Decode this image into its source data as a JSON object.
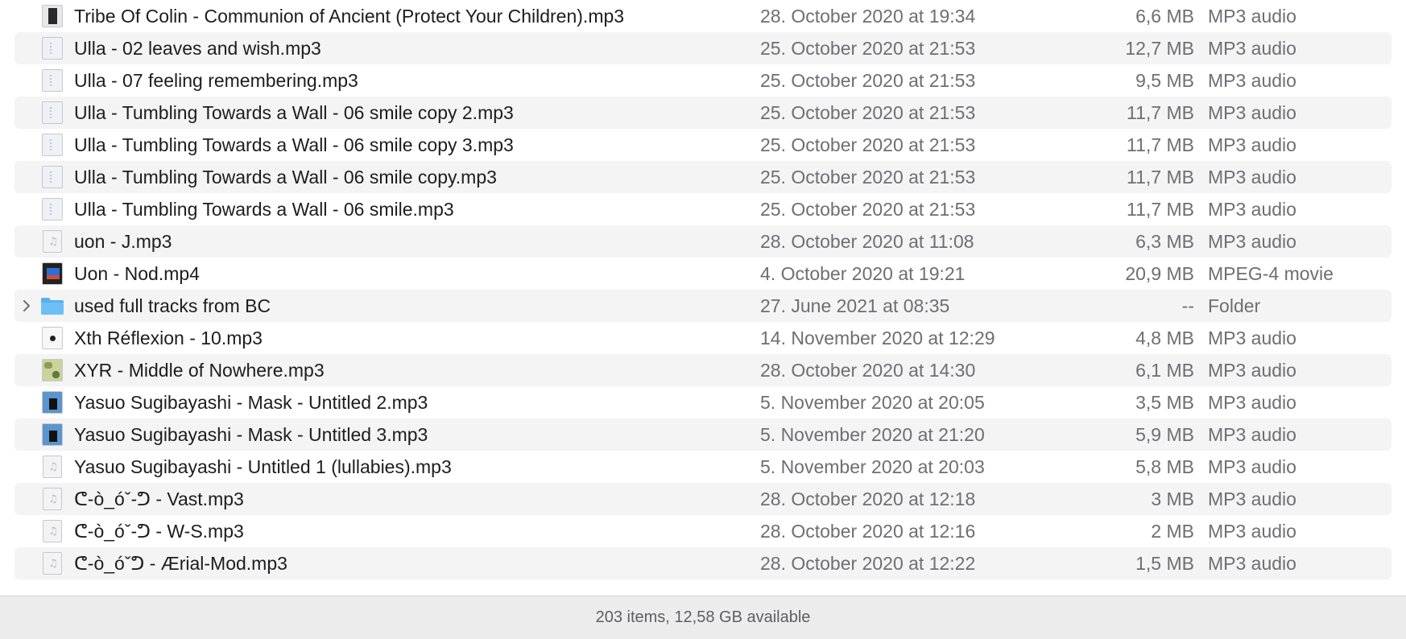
{
  "files": [
    {
      "name": "Tribe Of Colin - Communion of Ancient (Protect Your Children).mp3",
      "date": "28. October 2020 at 19:34",
      "size": "6,6 MB",
      "kind": "MP3 audio",
      "icon": "album-art-dark-icon"
    },
    {
      "name": "Ulla - 02 leaves and wish.mp3",
      "date": "25. October 2020 at 21:53",
      "size": "12,7 MB",
      "kind": "MP3 audio",
      "icon": "album-art-pale-icon"
    },
    {
      "name": "Ulla - 07 feeling remembering.mp3",
      "date": "25. October 2020 at 21:53",
      "size": "9,5 MB",
      "kind": "MP3 audio",
      "icon": "album-art-pale-icon"
    },
    {
      "name": "Ulla - Tumbling Towards a Wall - 06 smile copy 2.mp3",
      "date": "25. October 2020 at 21:53",
      "size": "11,7 MB",
      "kind": "MP3 audio",
      "icon": "album-art-pale-icon"
    },
    {
      "name": "Ulla - Tumbling Towards a Wall - 06 smile copy 3.mp3",
      "date": "25. October 2020 at 21:53",
      "size": "11,7 MB",
      "kind": "MP3 audio",
      "icon": "album-art-pale-icon"
    },
    {
      "name": "Ulla - Tumbling Towards a Wall - 06 smile copy.mp3",
      "date": "25. October 2020 at 21:53",
      "size": "11,7 MB",
      "kind": "MP3 audio",
      "icon": "album-art-pale-icon"
    },
    {
      "name": "Ulla - Tumbling Towards a Wall - 06 smile.mp3",
      "date": "25. October 2020 at 21:53",
      "size": "11,7 MB",
      "kind": "MP3 audio",
      "icon": "album-art-pale-icon"
    },
    {
      "name": "uon - J.mp3",
      "date": "28. October 2020 at 11:08",
      "size": "6,3 MB",
      "kind": "MP3 audio",
      "icon": "audio-document-icon"
    },
    {
      "name": "Uon - Nod.mp4",
      "date": "4. October 2020 at 19:21",
      "size": "20,9 MB",
      "kind": "MPEG-4 movie",
      "icon": "movie-thumbnail-icon"
    },
    {
      "name": "used full tracks from BC",
      "date": "27. June 2021 at 08:35",
      "size": "--",
      "kind": "Folder",
      "icon": "folder-icon"
    },
    {
      "name": "Xth Réflexion - 10.mp3",
      "date": "14. November 2020 at 12:29",
      "size": "4,8 MB",
      "kind": "MP3 audio",
      "icon": "album-art-dot-icon"
    },
    {
      "name": "XYR - Middle of Nowhere.mp3",
      "date": "28. October 2020 at 14:30",
      "size": "6,1 MB",
      "kind": "MP3 audio",
      "icon": "album-art-map-icon"
    },
    {
      "name": "Yasuo Sugibayashi - Mask - Untitled 2.mp3",
      "date": "5. November 2020 at 20:05",
      "size": "3,5 MB",
      "kind": "MP3 audio",
      "icon": "album-art-blue-icon"
    },
    {
      "name": "Yasuo Sugibayashi - Mask - Untitled 3.mp3",
      "date": "5. November 2020 at 21:20",
      "size": "5,9 MB",
      "kind": "MP3 audio",
      "icon": "album-art-blue-icon"
    },
    {
      "name": "Yasuo Sugibayashi - Untitled 1 (lullabies).mp3",
      "date": "5. November 2020 at 20:03",
      "size": "5,8 MB",
      "kind": "MP3 audio",
      "icon": "audio-document-icon"
    },
    {
      "name": "ᕦ-ò_óˇ-ᕤ - Vast.mp3",
      "date": "28. October 2020 at 12:18",
      "size": "3 MB",
      "kind": "MP3 audio",
      "icon": "audio-document-icon"
    },
    {
      "name": "ᕦ-ò_óˇ-ᕤ - W-S.mp3",
      "date": "28. October 2020 at 12:16",
      "size": "2 MB",
      "kind": "MP3 audio",
      "icon": "audio-document-icon"
    },
    {
      "name": "ᕦ-ò_óˇᕤ  - Ærial-Mod.mp3",
      "date": "28. October 2020 at 12:22",
      "size": "1,5 MB",
      "kind": "MP3 audio",
      "icon": "audio-document-icon"
    }
  ],
  "status_bar": {
    "text": "203 items, 12,58 GB available"
  },
  "colors": {
    "row_alt": "#f4f4f5",
    "text_primary": "#1d1d1f",
    "text_secondary": "#6e6e73",
    "folder_blue": "#5ab0ec"
  }
}
